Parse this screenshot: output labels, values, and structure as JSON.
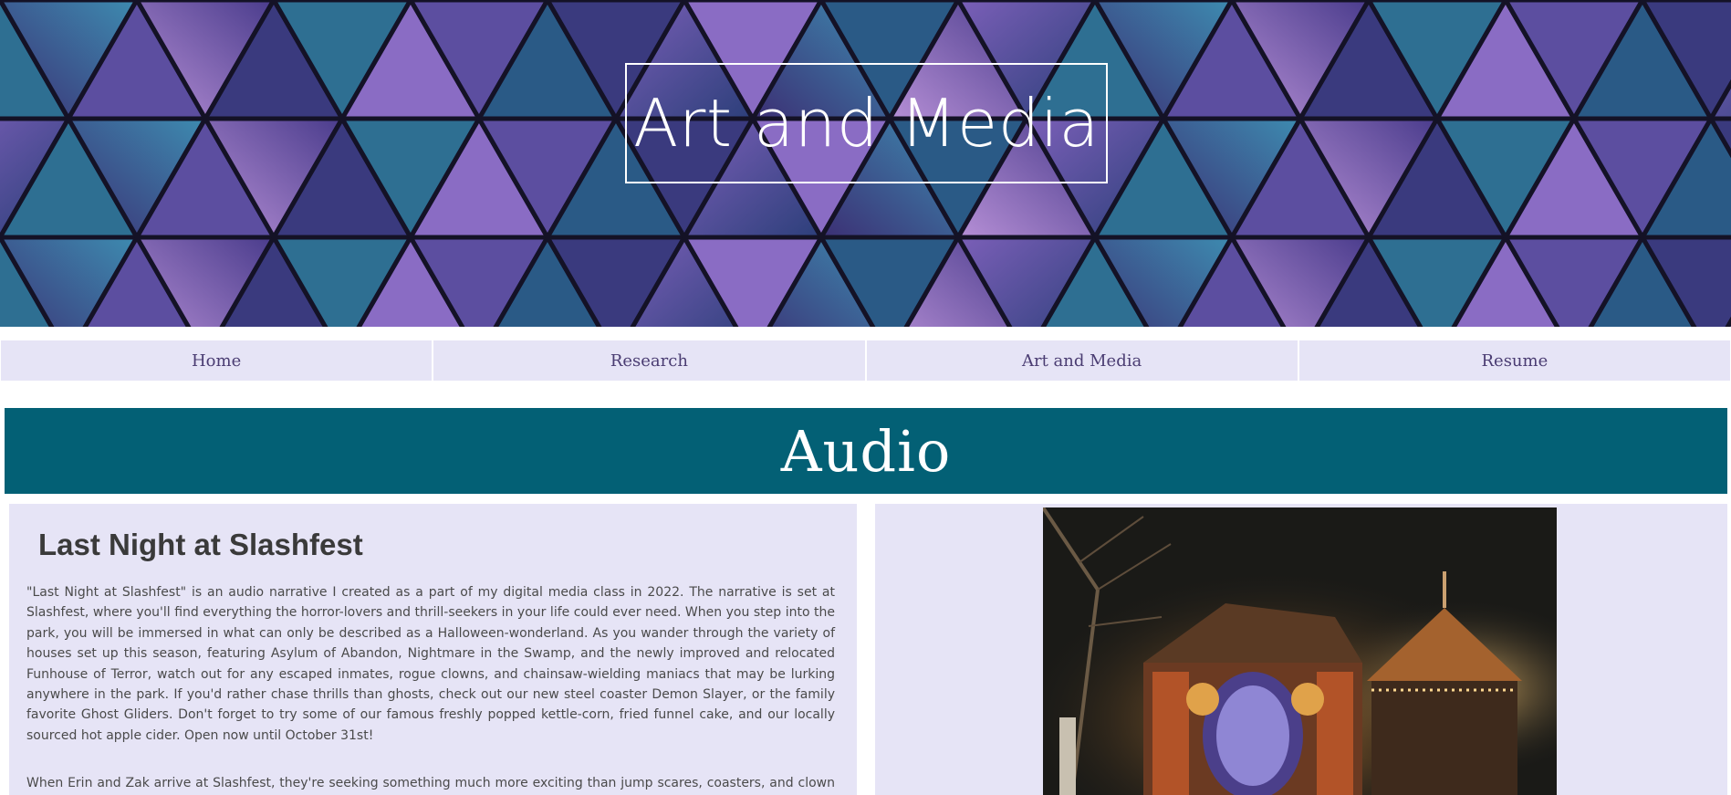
{
  "hero": {
    "title": "Art and Media"
  },
  "nav": {
    "items": [
      {
        "label": "Home"
      },
      {
        "label": "Research"
      },
      {
        "label": "Art and Media"
      },
      {
        "label": "Resume"
      }
    ]
  },
  "section": {
    "title": "Audio"
  },
  "article": {
    "title": "Last Night at Slashfest",
    "paragraph1": "\"Last Night at Slashfest\" is an audio narrative I created as a part of my digital media class in 2022. The narrative is set at Slashfest, where you'll find everything the horror-lovers and thrill-seekers in your life could ever need. When you step into the park, you will be immersed in what can only be described as a Halloween-wonderland. As you wander through the variety of houses set up this season, featuring Asylum of Abandon, Nightmare in the Swamp, and the newly improved and relocated Funhouse of Terror, watch out for any escaped inmates, rogue clowns, and chainsaw-wielding maniacs that may be lurking anywhere in the park. If you'd rather chase thrills than ghosts, check out our new steel coaster Demon Slayer, or the family favorite Ghost Gliders. Don't forget to try some of our famous freshly popped kettle-corn, fried funnel cake, and our locally sourced hot apple cider. Open now until October 31st!",
    "paragraph2": "When Erin and Zak arrive at Slashfest, they're seeking something much more exciting than jump scares, coasters, and clown costumes. After hearing rumors of the old funhouse being haunted, they decide to take a paranormal investigation"
  }
}
